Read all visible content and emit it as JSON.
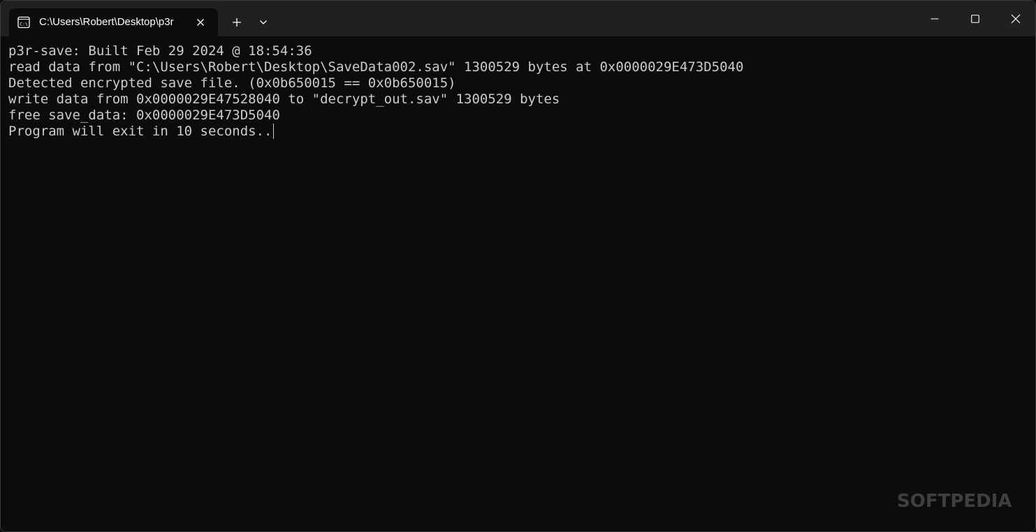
{
  "tab": {
    "title": "C:\\Users\\Robert\\Desktop\\p3r",
    "icon": "console-icon"
  },
  "titlebar": {
    "new_tab_icon": "plus-icon",
    "dropdown_icon": "chevron-down-icon",
    "minimize_icon": "minimize-icon",
    "maximize_icon": "maximize-icon",
    "close_icon": "close-icon"
  },
  "terminal": {
    "lines": [
      "p3r-save: Built Feb 29 2024 @ 18:54:36",
      "read data from \"C:\\Users\\Robert\\Desktop\\SaveData002.sav\" 1300529 bytes at 0x0000029E473D5040",
      "Detected encrypted save file. (0x0b650015 == 0x0b650015)",
      "write data from 0x0000029E47528040 to \"decrypt_out.sav\" 1300529 bytes",
      "free save_data: 0x0000029E473D5040",
      "Program will exit in 10 seconds.."
    ],
    "text_color": "#cccccc",
    "background_color": "#0c0c0c"
  },
  "watermark": {
    "text": "SOFTPEDIA"
  }
}
